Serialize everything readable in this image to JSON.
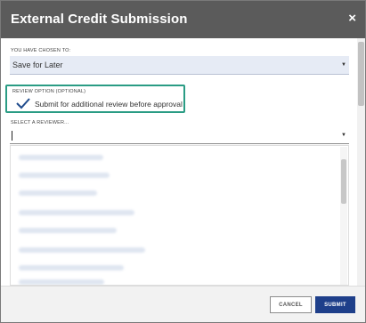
{
  "dialog": {
    "title": "External Credit Submission",
    "close_glyph": "×"
  },
  "choice": {
    "label": "YOU HAVE CHOSEN TO:",
    "value": "Save for Later",
    "caret": "▼"
  },
  "review_option": {
    "label": "REVIEW OPTION (OPTIONAL)",
    "checkbox_label": "Submit for additional review before approval",
    "checked": true,
    "highlight_color": "#2a9c84"
  },
  "reviewer": {
    "label": "SELECT A REVIEWER...",
    "value": "",
    "caret": "▼"
  },
  "footer": {
    "cancel_label": "CANCEL",
    "submit_label": "SUBMIT",
    "submit_color": "#1e3f8a"
  },
  "colors": {
    "titlebar": "#5b5b5b",
    "select_bg": "#e6ebf5"
  }
}
